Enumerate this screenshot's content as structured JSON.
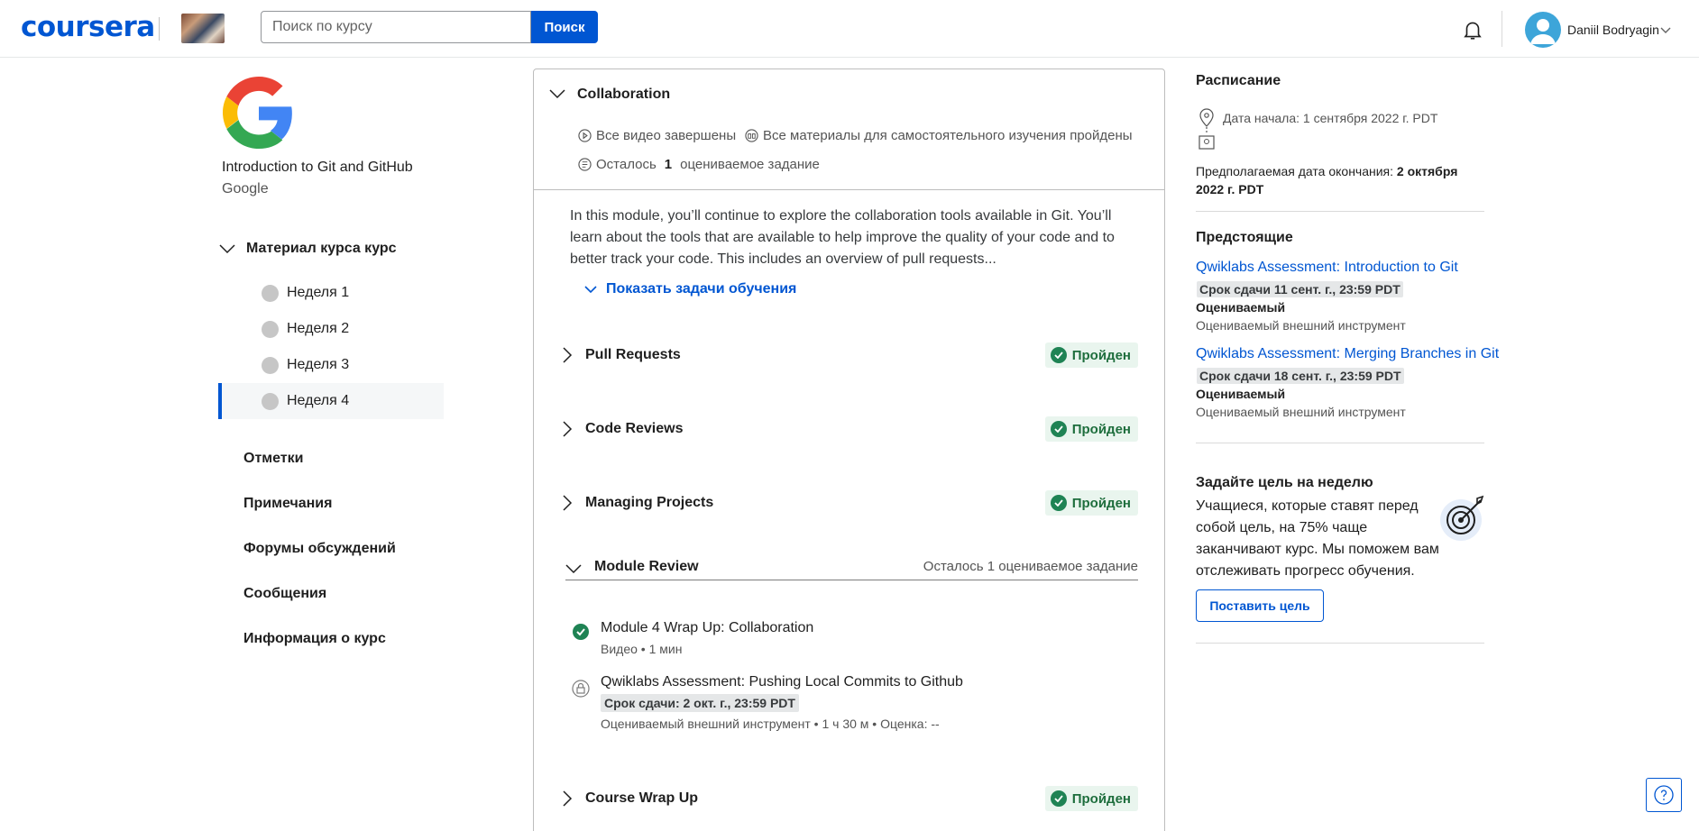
{
  "header": {
    "logo": "coursera",
    "search_placeholder": "Поиск по курсу",
    "search_button": "Поиск",
    "user_name": "Daniil Bodryagin"
  },
  "sidebar": {
    "course_title": "Introduction to Git and GitHub",
    "course_org": "Google",
    "materials_title": "Материал курса курс",
    "weeks": [
      {
        "label": "Неделя 1",
        "active": false
      },
      {
        "label": "Неделя 2",
        "active": false
      },
      {
        "label": "Неделя 3",
        "active": false
      },
      {
        "label": "Неделя 4",
        "active": true
      }
    ],
    "nav": [
      "Отметки",
      "Примечания",
      "Форумы обсуждений",
      "Сообщения",
      "Информация о курс"
    ]
  },
  "module": {
    "title": "Collaboration",
    "stat_videos": "Все видео завершены",
    "stat_readings": "Все материалы для самостоятельного изучения пройдены",
    "stat_remaining_prefix": "Осталось",
    "stat_remaining_count": "1",
    "stat_remaining_suffix": "оцениваемое задание",
    "description": "In this module, you’ll continue to explore the collaboration tools available in Git. You’ll learn about the tools that are available to help improve the quality of your code and to better track your code. This includes an overview of pull requests...",
    "show_tasks": "Показать задачи обучения",
    "lessons": [
      {
        "title": "Pull Requests",
        "status": "Пройден"
      },
      {
        "title": "Code Reviews",
        "status": "Пройден"
      },
      {
        "title": "Managing Projects",
        "status": "Пройден"
      }
    ],
    "review": {
      "title": "Module Review",
      "remaining": "Осталось 1 оцениваемое задание",
      "items": [
        {
          "title": "Module 4 Wrap Up: Collaboration",
          "meta": "Видео • 1 мин",
          "completed": true
        },
        {
          "title": "Qwiklabs Assessment: Pushing Local Commits to Github",
          "due": "Срок сдачи: 2 окт. г., 23:59 PDT",
          "meta": "Оцениваемый внешний инструмент • 1 ч 30 м • Оценка: --",
          "locked": true
        }
      ]
    },
    "wrap_up": {
      "title": "Course Wrap Up",
      "status": "Пройден"
    }
  },
  "schedule": {
    "title": "Расписание",
    "start": "Дата начала: 1 сентября 2022 г. PDT",
    "end_prefix": "Предполагаемая дата окончания:",
    "end_date": "2 октября 2022 г. PDT"
  },
  "upcoming": {
    "title": "Предстоящие",
    "items": [
      {
        "title": "Qwiklabs Assessment: Introduction to Git",
        "due": "Срок сдачи 11 сент. г., 23:59 PDT",
        "type": "Оцениваемый",
        "sub": "Оцениваемый внешний инструмент"
      },
      {
        "title": "Qwiklabs Assessment: Merging Branches in Git",
        "due": "Срок сдачи 18 сент. г., 23:59 PDT",
        "type": "Оцениваемый",
        "sub": "Оцениваемый внешний инструмент"
      }
    ]
  },
  "goal": {
    "title": "Задайте цель на неделю",
    "text": "Учащиеся, которые ставят перед собой цель, на 75% чаще заканчивают курс. Мы поможем вам отслеживать прогресс обучения.",
    "button": "Поставить цель"
  },
  "colors": {
    "brand": "#0056d2",
    "success": "#1f8354",
    "success_bg": "#e9f5ee"
  }
}
